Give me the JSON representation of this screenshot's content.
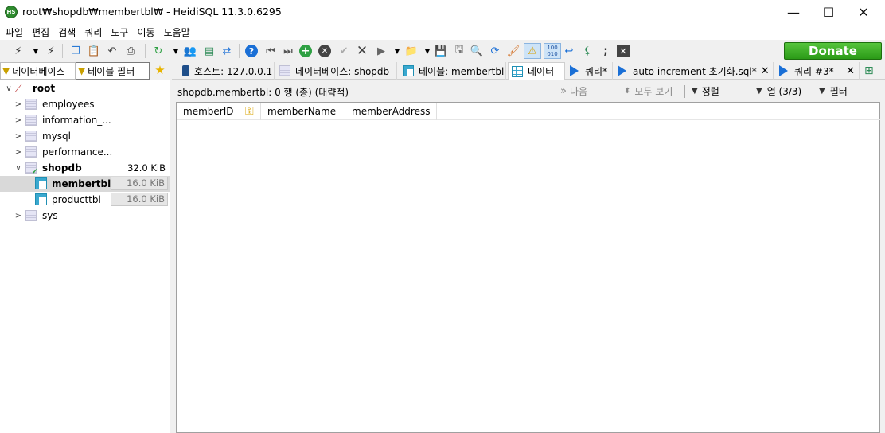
{
  "window": {
    "title": "root₩shopdb₩membertbl₩ - HeidiSQL 11.3.0.6295",
    "app_icon_text": "HS",
    "minimize": "—",
    "maximize": "☐",
    "close": "✕"
  },
  "menu": [
    "파일",
    "편집",
    "검색",
    "쿼리",
    "도구",
    "이동",
    "도움말"
  ],
  "toolbar": {
    "donate_label": "Donate",
    "icons": [
      "connect-icon",
      "disconnect-icon",
      "copy-icon",
      "paste-icon",
      "undo-icon",
      "print-icon",
      "refresh-icon",
      "user-manager-icon",
      "export-icon",
      "sync-icon",
      "help-icon",
      "first-icon",
      "last-icon",
      "insert-icon",
      "cancel-icon",
      "post-icon",
      "delete-icon",
      "run-icon",
      "open-icon",
      "save-icon",
      "save-as-icon",
      "find-icon",
      "replace-icon",
      "clean-icon",
      "warning-icon",
      "binary-icon",
      "wrap-icon",
      "format-icon",
      "semicolon-icon",
      "close-query-icon"
    ]
  },
  "left_panel": {
    "db_filter": "데이터베이스",
    "table_filter": "테이블 필터",
    "tree": [
      {
        "label": "root",
        "chevron": "∨"
      },
      {
        "label": "employees",
        "chevron": ">"
      },
      {
        "label": "information_...",
        "chevron": ">"
      },
      {
        "label": "mysql",
        "chevron": ">"
      },
      {
        "label": "performance...",
        "chevron": ">"
      },
      {
        "label": "shopdb",
        "chevron": "∨",
        "size": "32.0 KiB"
      },
      {
        "label": "membertbl",
        "size": "16.0 KiB"
      },
      {
        "label": "producttbl",
        "size": "16.0 KiB"
      },
      {
        "label": "sys",
        "chevron": ">"
      }
    ]
  },
  "tabs": [
    {
      "label": "호스트: 127.0.0.1"
    },
    {
      "label": "데이터베이스: shopdb"
    },
    {
      "label": "테이블: membertbl"
    },
    {
      "label": "데이터"
    },
    {
      "label": "쿼리*"
    },
    {
      "label": "auto increment 초기화.sql*",
      "close": "✕"
    },
    {
      "label": "쿼리 #3*",
      "close": "✕"
    }
  ],
  "infobar": {
    "text": "shopdb.membertbl: 0 행 (총) (대략적)",
    "next": "다음",
    "show_all": "모두 보기",
    "sort": "정렬",
    "columns": "열 (3/3)",
    "filter": "필터"
  },
  "grid": {
    "columns": [
      "memberID",
      "memberName",
      "memberAddress"
    ]
  }
}
